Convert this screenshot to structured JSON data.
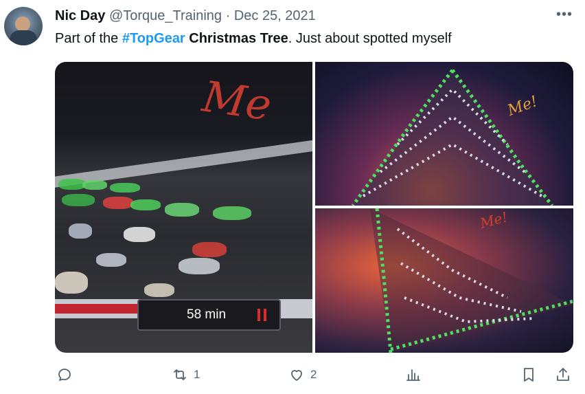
{
  "tweet": {
    "author_name": "Nic Day",
    "handle": "@Torque_Training",
    "separator": "·",
    "date": "Dec 25, 2021",
    "more": "•••",
    "text_prefix": "Part of the ",
    "hashtag": "#TopGear",
    "text_bold": " Christmas Tree",
    "text_suffix": ". Just about spotted myself"
  },
  "media": {
    "left_image": {
      "timer_text": "58 min",
      "timer_progress": 0.62,
      "annotation": "Me"
    },
    "top_right_image": {
      "annotation": "Me!"
    },
    "bottom_right_image": {
      "annotation": "Me!"
    }
  },
  "actions": {
    "reply": {
      "icon": "reply-icon",
      "count": ""
    },
    "retweet": {
      "icon": "retweet-icon",
      "count": "1"
    },
    "like": {
      "icon": "heart-icon",
      "count": "2"
    },
    "views": {
      "icon": "analytics-icon",
      "count": ""
    },
    "bookmark": {
      "icon": "bookmark-icon"
    },
    "share": {
      "icon": "share-icon"
    }
  },
  "colors": {
    "hashtag": "#1d9bf0",
    "secondary_text": "#536471",
    "primary_text": "#0f1419"
  }
}
